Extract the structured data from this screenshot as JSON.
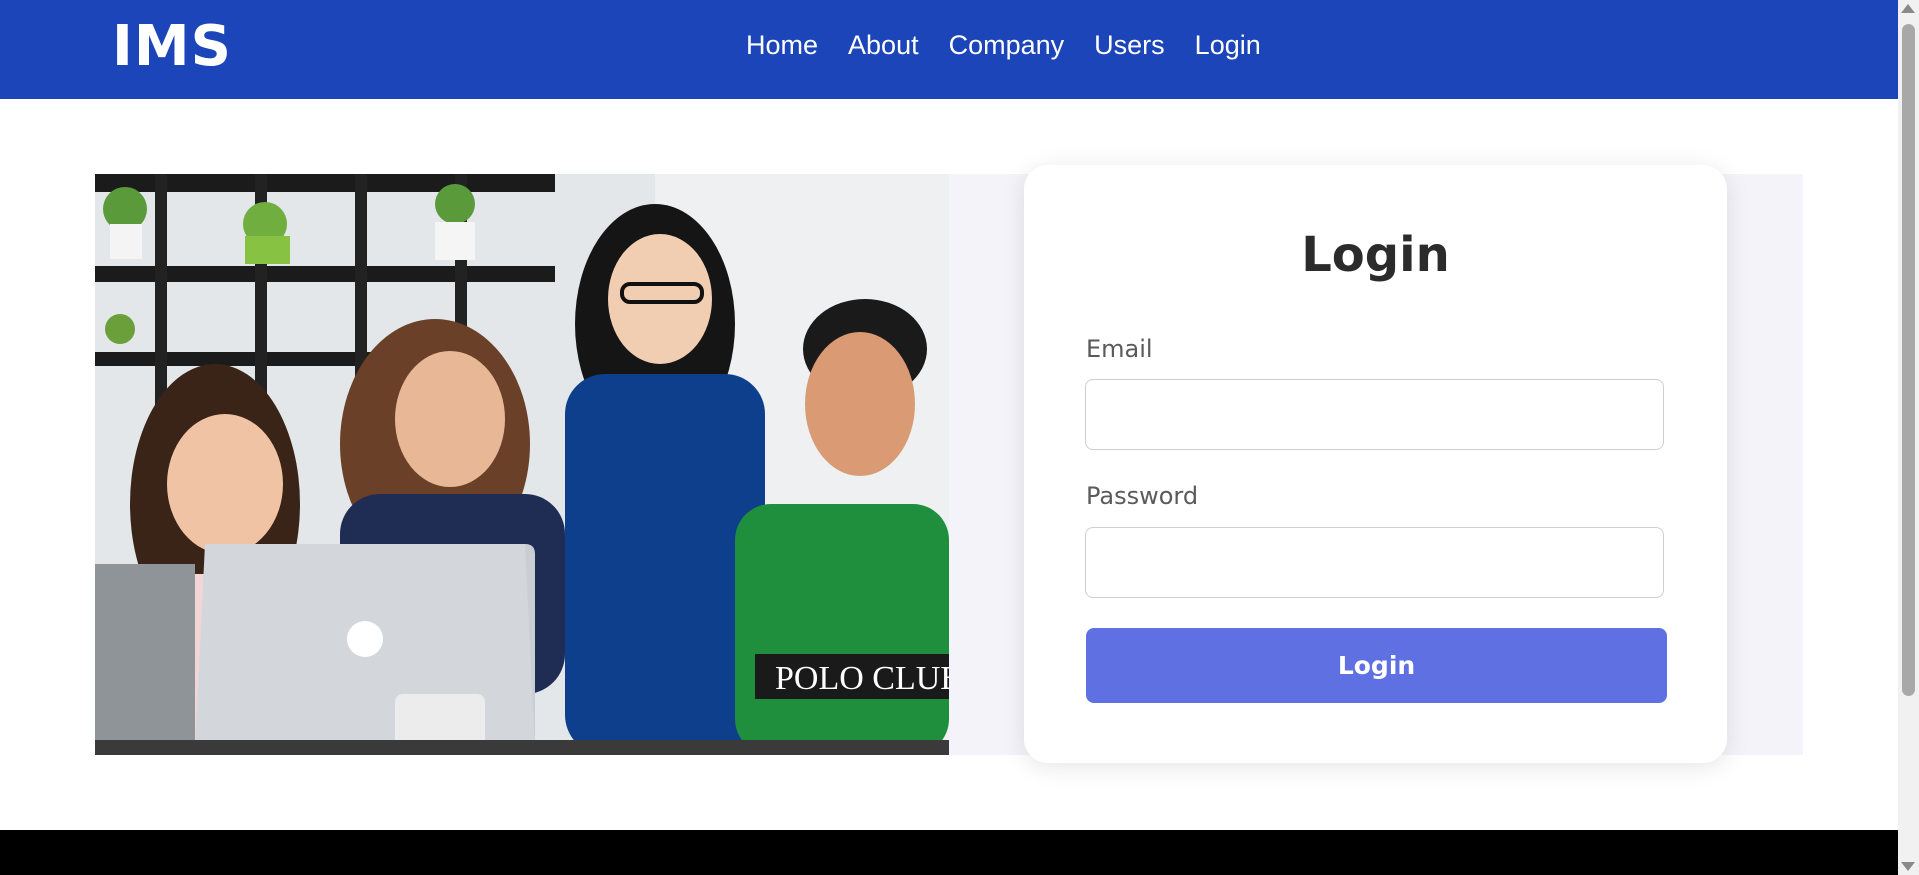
{
  "brand": "IMS",
  "nav": {
    "items": [
      "Home",
      "About",
      "Company",
      "Users",
      "Login"
    ]
  },
  "login_card": {
    "title": "Login",
    "email_label": "Email",
    "email_value": "",
    "password_label": "Password",
    "password_value": "",
    "submit_label": "Login"
  },
  "colors": {
    "navbar": "#1b45b8",
    "button": "#5f70e3",
    "band": "#f3f3f9",
    "footer": "#000000"
  },
  "hero_image": "team-around-laptop-photo"
}
